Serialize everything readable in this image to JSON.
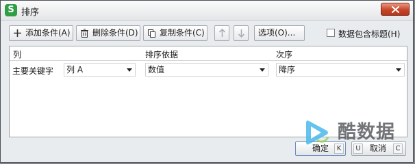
{
  "window": {
    "title": "排序",
    "app_logo": "S"
  },
  "toolbar": {
    "add_label": "添加条件(A)",
    "delete_label": "删除条件(D)",
    "copy_label": "复制条件(C)",
    "options_label": "选项(O)...",
    "header_checkbox_label": "数据包含标题(H)",
    "header_checkbox_checked": false
  },
  "grid": {
    "headers": [
      "列",
      "排序依据",
      "次序"
    ],
    "rows": [
      {
        "label": "主要关键字",
        "column": "列 A",
        "sort_on": "数值",
        "order": "降序"
      }
    ]
  },
  "footer": {
    "ok_label": "确定",
    "ok_hint": "K",
    "cancel_label": "取消",
    "cancel_hint_left": "U",
    "cancel_hint_right": "C"
  },
  "watermark": {
    "text": "酷数据"
  },
  "colors": {
    "close_button": "#c74528",
    "app_logo": "#2f9e44",
    "watermark_play": "#4bb8ea"
  }
}
